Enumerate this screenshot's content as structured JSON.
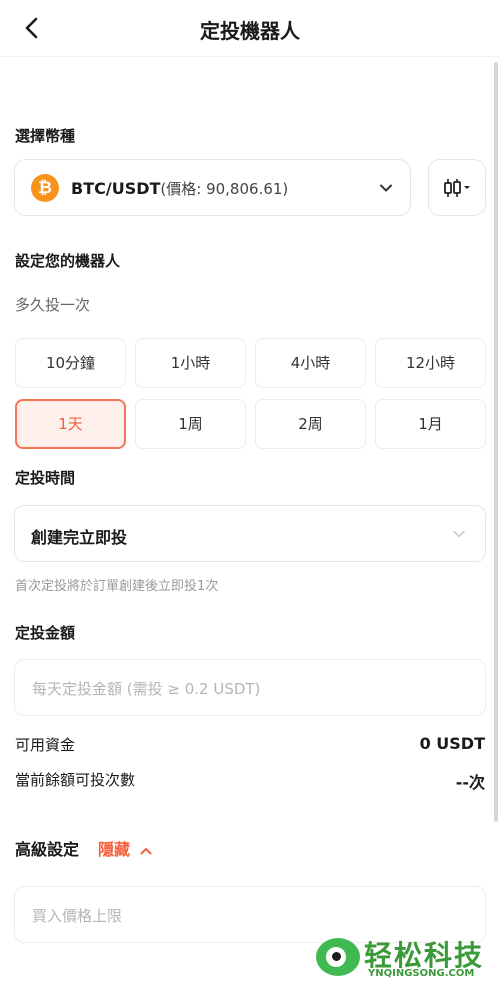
{
  "header": {
    "title": "定投機器人"
  },
  "coin_section": {
    "label": "選擇幣種",
    "pair": "BTC/USDT",
    "price_text": "(價格: 90,806.61)",
    "coin_symbol": "₿"
  },
  "robot_section": {
    "label": "設定您的機器人",
    "frequency_label": "多久投一次",
    "frequencies": [
      "10分鐘",
      "1小時",
      "4小時",
      "12小時",
      "1天",
      "1周",
      "2周",
      "1月"
    ],
    "selected_frequency": "1天"
  },
  "time_section": {
    "label": "定投時間",
    "value": "創建完立即投",
    "hint": "首次定投將於訂單創建後立即投1次"
  },
  "amount_section": {
    "label": "定投金額",
    "placeholder": "每天定投金額 (需投 ≥ 0.2 USDT)"
  },
  "funds": {
    "available_label": "可用資金",
    "available_value": "0 USDT",
    "times_label": "當前餘額可投次數",
    "times_value": "--次"
  },
  "advanced": {
    "label": "高級設定",
    "toggle": "隱藏",
    "price_limit_placeholder": "買入價格上限"
  },
  "watermark": {
    "brand": "轻松科技",
    "url": "YNQINGSONG.COM"
  },
  "colors": {
    "accent": "#f5613f",
    "btc": "#f7931a",
    "watermark": "#3a9a3a"
  }
}
